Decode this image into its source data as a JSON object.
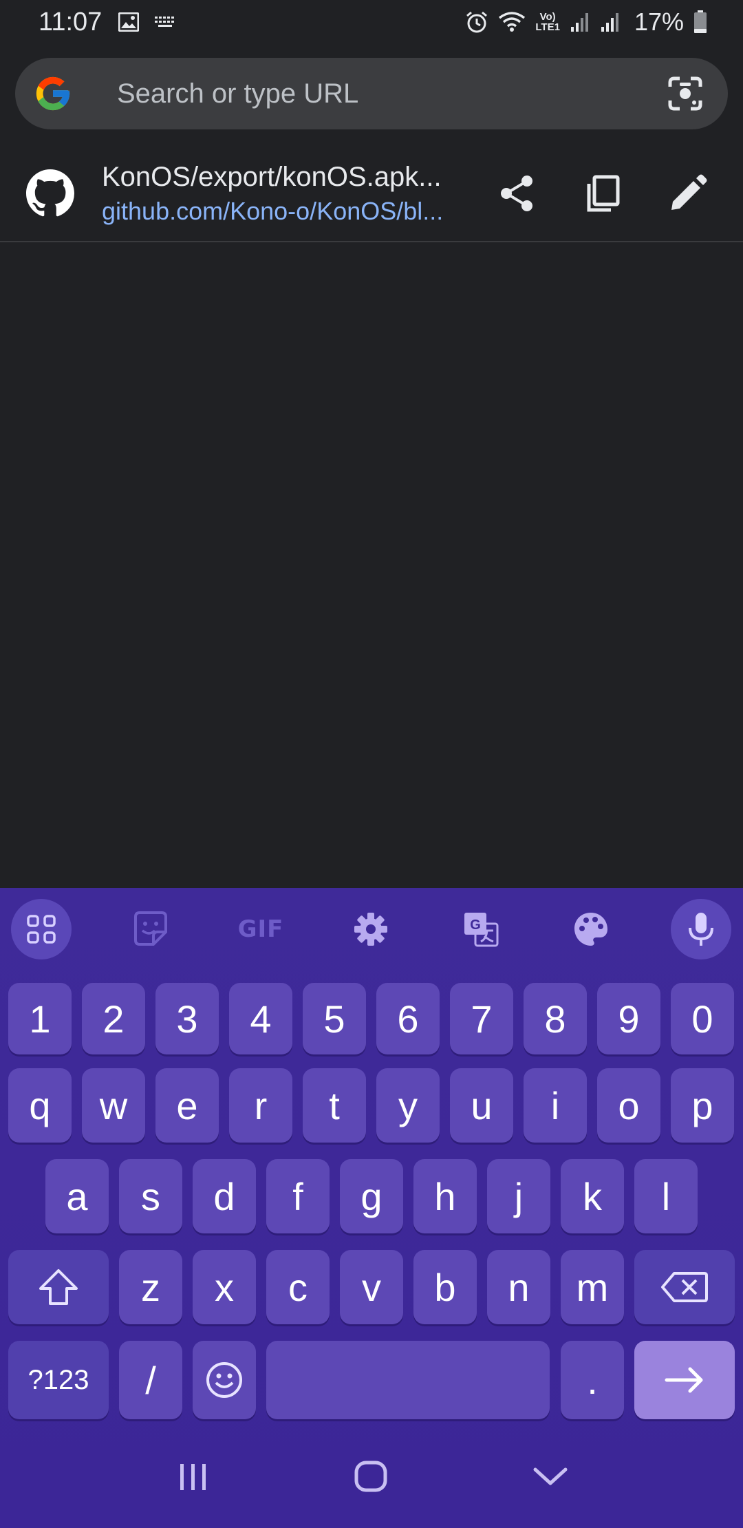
{
  "status_bar": {
    "time": "11:07",
    "battery_percent": "17%",
    "left_icons": [
      "image-icon",
      "keyboard-icon"
    ],
    "right_icons": [
      "alarm-icon",
      "wifi-icon",
      "volte-icon",
      "signal-icon",
      "signal-icon",
      "battery-icon"
    ],
    "volte_label_top": "Vo)",
    "volte_label_bottom": "LTE1"
  },
  "omnibox": {
    "placeholder": "Search or type URL",
    "left_icon": "google-logo-icon",
    "right_icon": "google-lens-icon"
  },
  "suggestion": {
    "title": "KonOS/export/konOS.apk...",
    "url": "github.com/Kono-o/KonOS/bl...",
    "site_icon": "github-icon",
    "actions": [
      "share-icon",
      "copy-icon",
      "edit-icon"
    ]
  },
  "keyboard": {
    "toolbar": [
      "apps-grid-icon",
      "sticker-icon",
      "gif-icon",
      "settings-icon",
      "translate-icon",
      "palette-icon",
      "mic-icon"
    ],
    "gif_label": "GIF",
    "row_numbers": [
      "1",
      "2",
      "3",
      "4",
      "5",
      "6",
      "7",
      "8",
      "9",
      "0"
    ],
    "row_1": [
      "q",
      "w",
      "e",
      "r",
      "t",
      "y",
      "u",
      "i",
      "o",
      "p"
    ],
    "row_2": [
      "a",
      "s",
      "d",
      "f",
      "g",
      "h",
      "j",
      "k",
      "l"
    ],
    "row_3": [
      "z",
      "x",
      "c",
      "v",
      "b",
      "n",
      "m"
    ],
    "symbols_key": "?123",
    "slash_key": "/",
    "period_key": ".",
    "colors": {
      "background": "#3e2a9e",
      "key": "#5d48b5",
      "enter": "#9a83dd"
    }
  },
  "nav_bar": [
    "recents-icon",
    "home-icon",
    "back-icon"
  ]
}
